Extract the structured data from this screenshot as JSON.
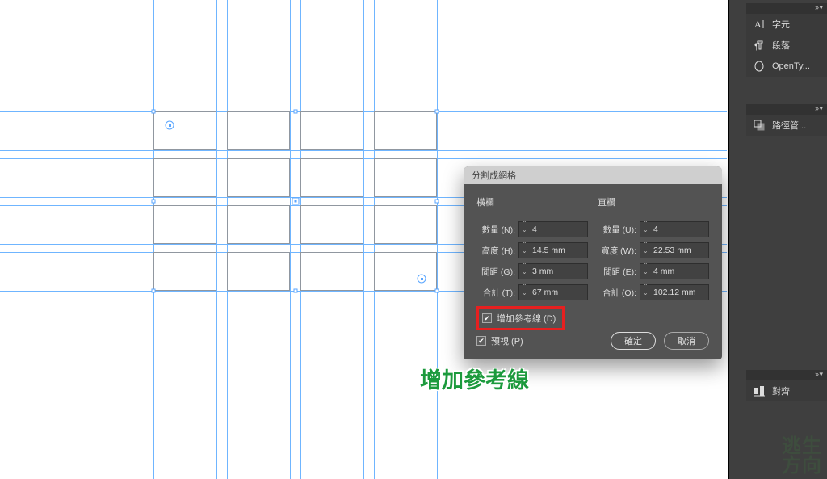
{
  "dialog": {
    "title": "分割成網格",
    "rows_header": "橫欄",
    "cols_header": "直欄",
    "rows": {
      "number_label": "數量 (N):",
      "number_value": "4",
      "height_label": "高度 (H):",
      "height_value": "14.5 mm",
      "gutter_label": "間距 (G):",
      "gutter_value": "3 mm",
      "total_label": "合計 (T):",
      "total_value": "67 mm"
    },
    "cols": {
      "number_label": "數量 (U):",
      "number_value": "4",
      "width_label": "寬度 (W):",
      "width_value": "22.53 mm",
      "gutter_label": "間距 (E):",
      "gutter_value": "4 mm",
      "total_label": "合計 (O):",
      "total_value": "102.12 mm"
    },
    "add_guides_label": "增加參考線 (D)",
    "preview_label": "預視 (P)",
    "ok_label": "確定",
    "cancel_label": "取消"
  },
  "annotation": "增加參考線",
  "panels": {
    "grip": "›› ▾",
    "character": "字元",
    "paragraph": "段落",
    "opentype": "OpenTy...",
    "pathfinder": "路徑管...",
    "align": "對齊"
  },
  "watermark": {
    "l1": "逃生",
    "l2": "方向"
  }
}
